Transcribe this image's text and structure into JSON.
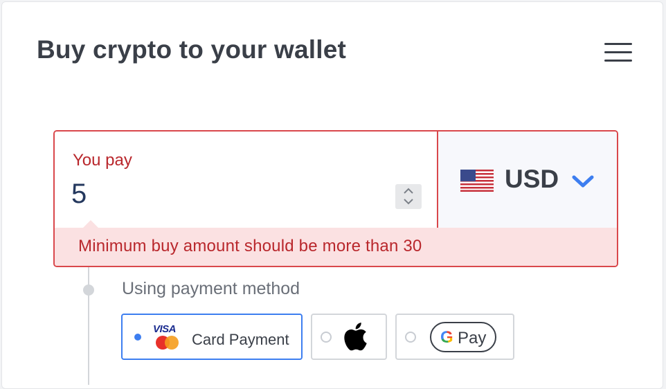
{
  "header": {
    "title": "Buy crypto to your wallet"
  },
  "pay": {
    "label": "You pay",
    "amount": "5",
    "currency_code": "USD",
    "error_message": "Minimum buy amount should be more than 30"
  },
  "payment_method": {
    "label": "Using payment method",
    "options": [
      {
        "id": "card",
        "label": "Card Payment",
        "brand_text": "VISA",
        "selected": true
      },
      {
        "id": "apple-pay",
        "icon": "apple-icon",
        "selected": false
      },
      {
        "id": "google-pay",
        "brand_text": "Pay",
        "icon": "google-g-icon",
        "selected": false
      }
    ]
  },
  "colors": {
    "accent": "#3d7ef0",
    "error": "#b9272c",
    "error_border": "#d9474b",
    "error_bg": "#fbe1e2",
    "text": "#3a3f48"
  }
}
